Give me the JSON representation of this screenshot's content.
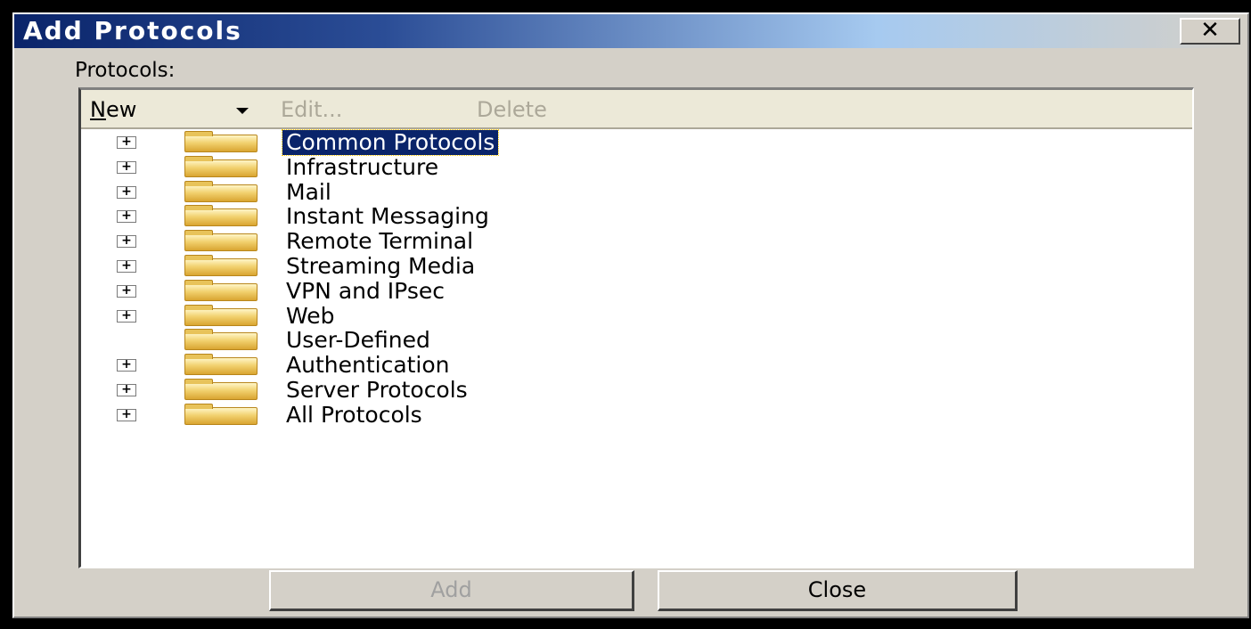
{
  "window": {
    "title": "Add Protocols",
    "close_glyph": "✕"
  },
  "group_label": "Protocols:",
  "toolbar": {
    "new_prefix": "N",
    "new_rest": "ew",
    "edit_label": "Edit...",
    "delete_label": "Delete"
  },
  "tree": {
    "items": [
      {
        "label": "Common Protocols",
        "expandable": true,
        "selected": true
      },
      {
        "label": "Infrastructure",
        "expandable": true
      },
      {
        "label": "Mail",
        "expandable": true
      },
      {
        "label": "Instant Messaging",
        "expandable": true
      },
      {
        "label": "Remote Terminal",
        "expandable": true
      },
      {
        "label": "Streaming Media",
        "expandable": true
      },
      {
        "label": "VPN and IPsec",
        "expandable": true
      },
      {
        "label": "Web",
        "expandable": true
      },
      {
        "label": "User-Defined",
        "expandable": false
      },
      {
        "label": "Authentication",
        "expandable": true
      },
      {
        "label": "Server Protocols",
        "expandable": true
      },
      {
        "label": "All Protocols",
        "expandable": true
      }
    ]
  },
  "buttons": {
    "add_label": "Add",
    "close_label": "Close"
  },
  "expander_glyph": "+",
  "colors": {
    "title_bar": "#0a246a",
    "selection": "#0a246a",
    "dialog_bg": "#d4d0c8"
  }
}
